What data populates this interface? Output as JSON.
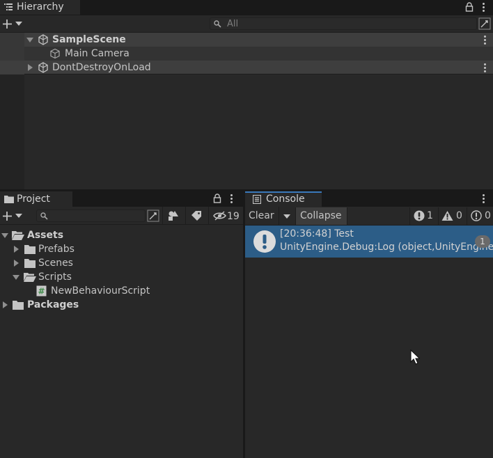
{
  "hierarchy": {
    "tab_label": "Hierarchy",
    "search_placeholder": "All",
    "items": [
      {
        "label": "SampleScene"
      },
      {
        "label": "Main Camera"
      },
      {
        "label": "DontDestroyOnLoad"
      }
    ]
  },
  "project": {
    "tab_label": "Project",
    "hidden_count": "19",
    "tree": [
      {
        "label": "Assets"
      },
      {
        "label": "Prefabs"
      },
      {
        "label": "Scenes"
      },
      {
        "label": "Scripts"
      },
      {
        "label": "NewBehaviourScript"
      },
      {
        "label": "Packages"
      }
    ]
  },
  "console": {
    "tab_label": "Console",
    "clear_label": "Clear",
    "collapse_label": "Collapse",
    "error_count": "1",
    "warning_count": "0",
    "info_count": "0",
    "entry": {
      "line1": "[20:36:48] Test",
      "line2": "UnityEngine.Debug:Log (object,UnityEngine.Object)",
      "count": "1"
    }
  },
  "colors": {
    "selection": "#2c5d87",
    "panel_bg": "#282828",
    "toolbar_bg": "#3c3c3c",
    "accent_tab": "#3a79bb"
  }
}
